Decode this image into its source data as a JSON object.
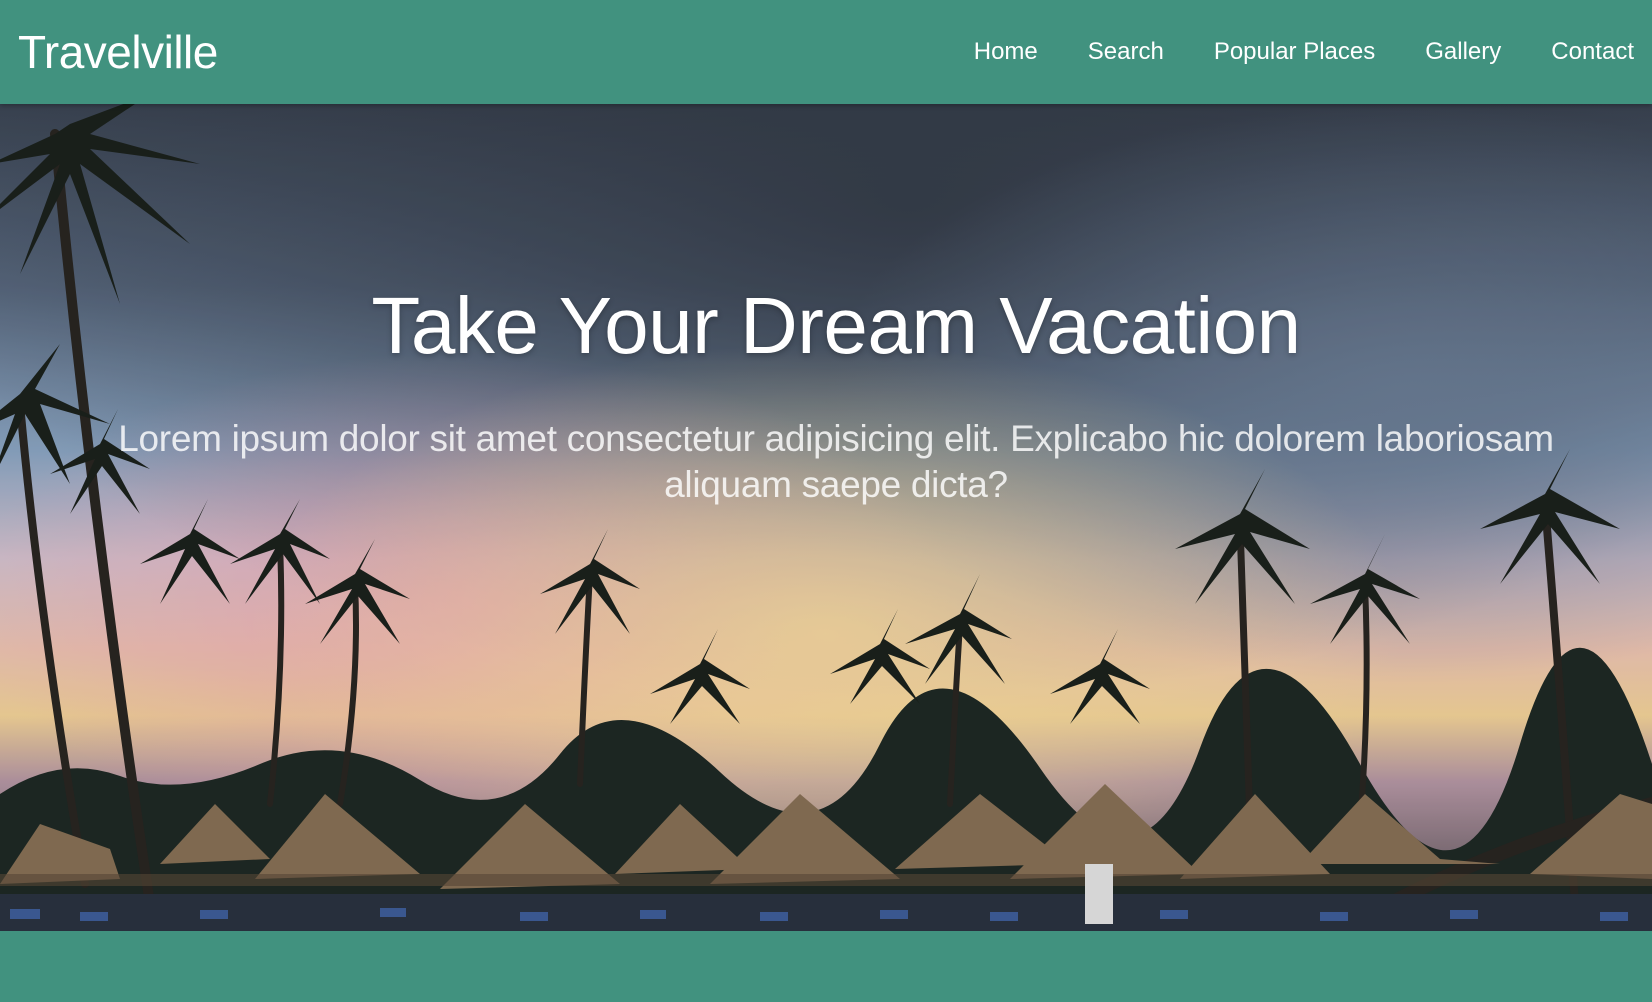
{
  "brand": "Travelville",
  "nav": {
    "items": [
      {
        "label": "Home"
      },
      {
        "label": "Search"
      },
      {
        "label": "Popular Places"
      },
      {
        "label": "Gallery"
      },
      {
        "label": "Contact"
      }
    ]
  },
  "hero": {
    "title": "Take Your Dream Vacation",
    "subtitle": "Lorem ipsum dolor sit amet consectetur adipisicing elit. Explicabo hic dolorem laboriosam aliquam saepe dicta?"
  },
  "colors": {
    "brand_green": "#41927f",
    "text": "#ffffff"
  }
}
